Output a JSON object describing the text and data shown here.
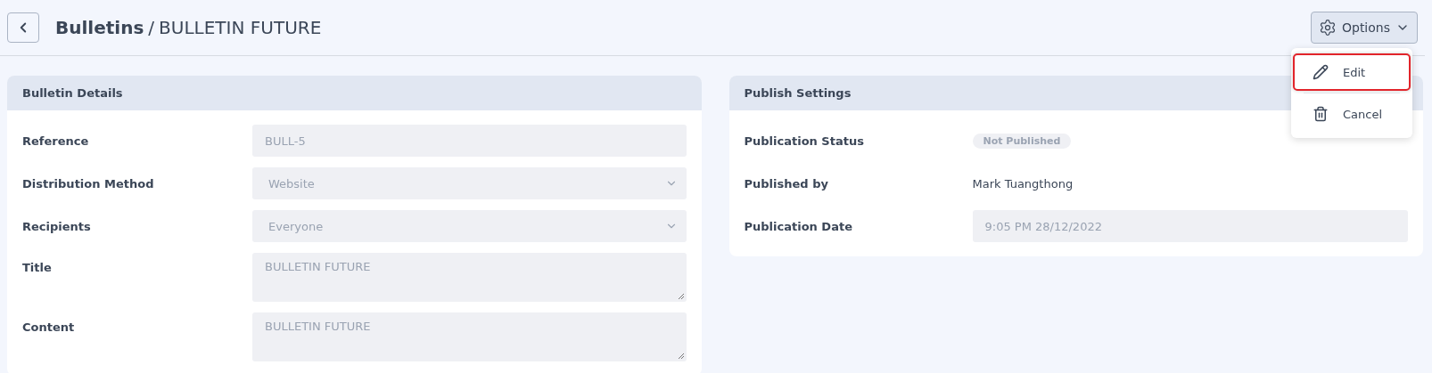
{
  "header": {
    "breadcrumb_parent": "Bulletins",
    "separator": "/",
    "title": "BULLETIN FUTURE"
  },
  "options_button": {
    "label": "Options",
    "expanded": true
  },
  "options_menu": [
    {
      "kind": "edit",
      "label": "Edit",
      "highlighted": true
    },
    {
      "kind": "cancel",
      "label": "Cancel",
      "highlighted": false
    }
  ],
  "bulletin_details": {
    "title": "Bulletin Details",
    "fields": [
      {
        "kind": "text",
        "label": "Reference",
        "value": "BULL-5",
        "disabled": true
      },
      {
        "kind": "select",
        "label": "Distribution Method",
        "value": "Website",
        "disabled": true
      },
      {
        "kind": "select",
        "label": "Recipients",
        "value": "Everyone",
        "disabled": true
      },
      {
        "kind": "textarea",
        "label": "Title",
        "value": "BULLETIN FUTURE",
        "disabled": true
      },
      {
        "kind": "textarea",
        "label": "Content",
        "value": "BULLETIN FUTURE",
        "disabled": true
      }
    ]
  },
  "publish_settings": {
    "title": "Publish Settings",
    "fields": [
      {
        "kind": "badge",
        "label": "Publication Status",
        "value": "Not Published"
      },
      {
        "kind": "plain",
        "label": "Published by",
        "value": "Mark Tuangthong"
      },
      {
        "kind": "text",
        "label": "Publication Date",
        "value": "9:05 PM 28/12/2022",
        "disabled": true
      }
    ]
  }
}
